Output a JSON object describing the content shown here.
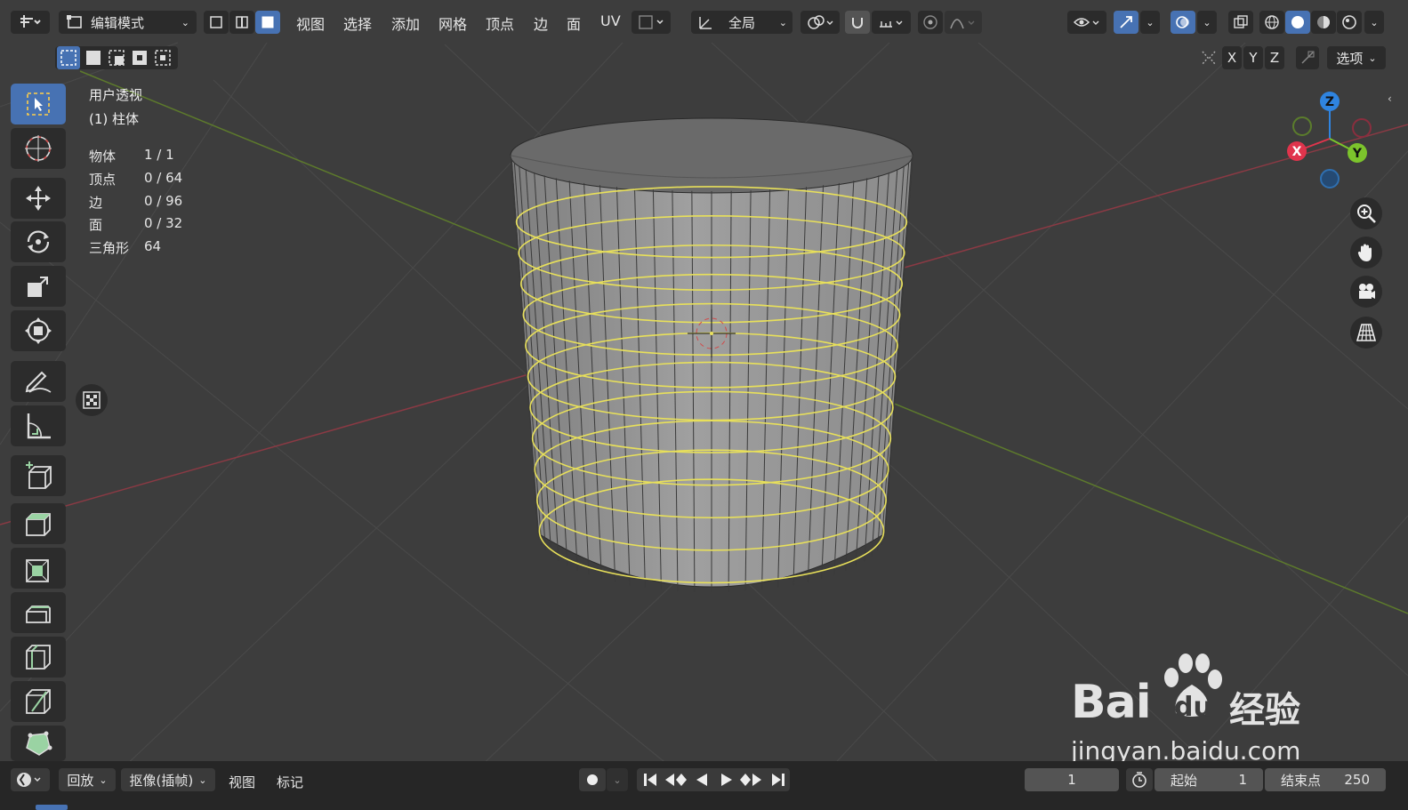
{
  "header": {
    "mode": "编辑模式",
    "menus": [
      "视图",
      "选择",
      "添加",
      "网格",
      "顶点",
      "边",
      "面",
      "UV"
    ],
    "transform_orientation": "全局",
    "axes": [
      "X",
      "Y",
      "Z"
    ],
    "options": "选项"
  },
  "overlay": {
    "view_name": "用户透视",
    "object_name": "(1) 柱体",
    "stats": [
      {
        "label": "物体",
        "value": "1 / 1"
      },
      {
        "label": "顶点",
        "value": "0 / 64"
      },
      {
        "label": "边",
        "value": "0 / 96"
      },
      {
        "label": "面",
        "value": "0 / 32"
      },
      {
        "label": "三角形",
        "value": "64"
      }
    ]
  },
  "gizmo": {
    "z": "Z",
    "x": "X",
    "y": "Y"
  },
  "timeline": {
    "playback": "回放",
    "keying": "抠像(插帧)",
    "view": "视图",
    "marker": "标记",
    "current_frame": "1",
    "start_label": "起始",
    "start_value": "1",
    "end_label": "结束点",
    "end_value": "250"
  },
  "watermark": {
    "brand": "Bai",
    "brand2": "du",
    "brand_cn": "经验",
    "url": "jingyan.baidu.com"
  },
  "colors": {
    "accent": "#4772b3",
    "selection": "#e8e05a",
    "axis_x": "#e0344c",
    "axis_y": "#7cc42c",
    "axis_z": "#2f84e0"
  }
}
